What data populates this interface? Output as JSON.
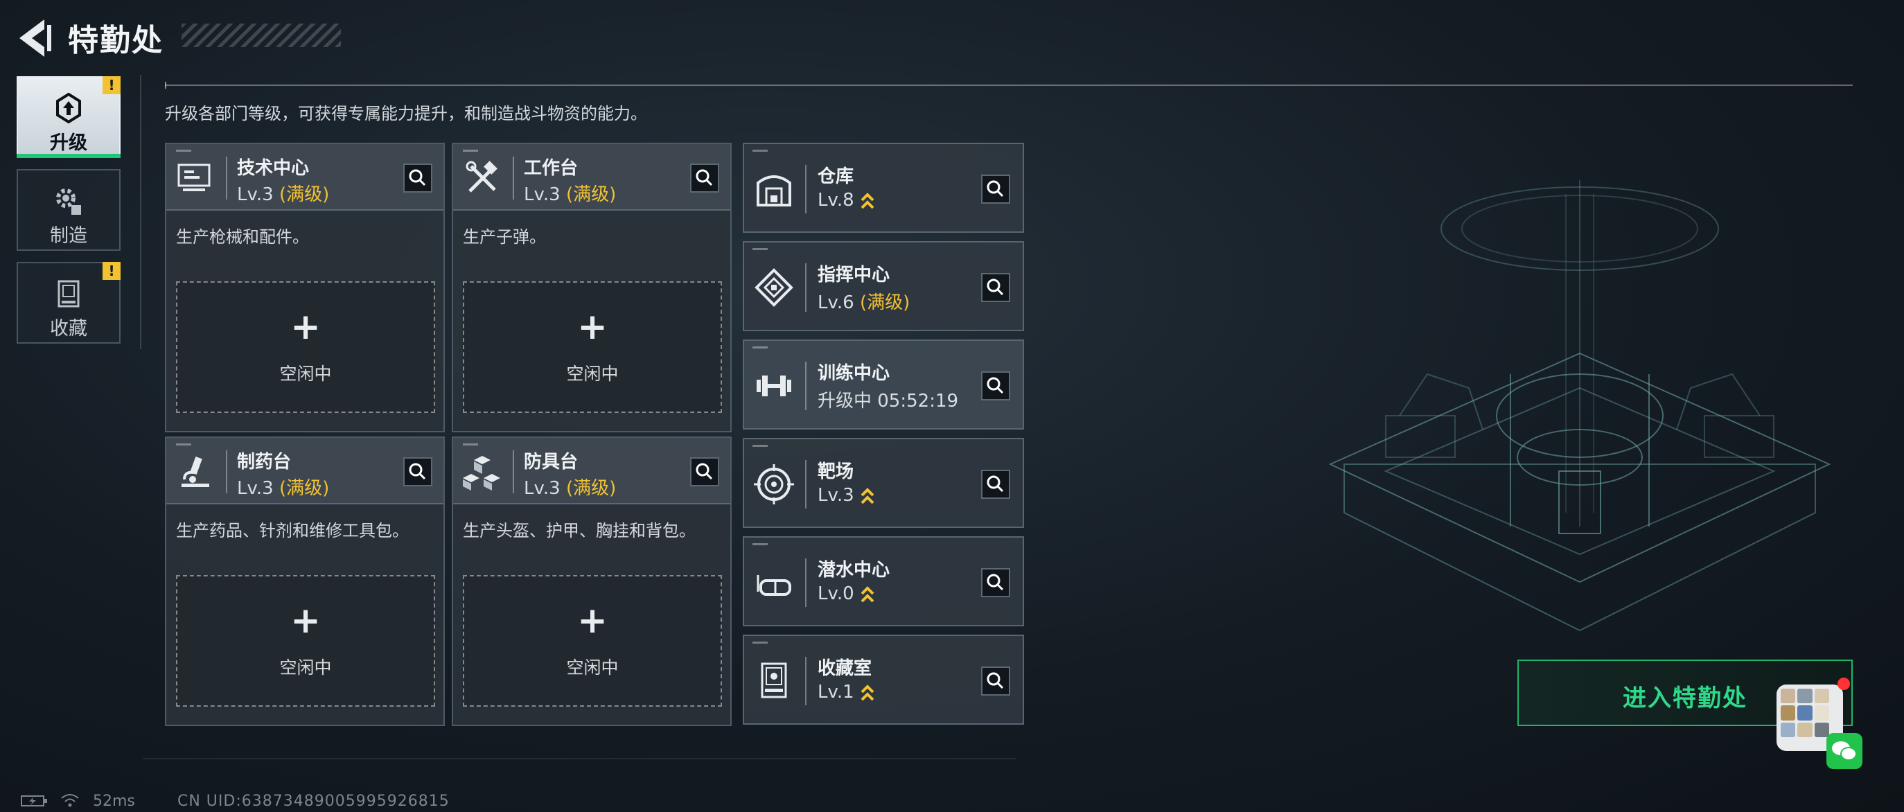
{
  "header": {
    "title": "特勤处"
  },
  "nav": {
    "items": [
      {
        "label": "升级",
        "icon": "upgrade-icon",
        "active": true,
        "badge": "!"
      },
      {
        "label": "制造",
        "icon": "gear-icon",
        "active": false,
        "badge": ""
      },
      {
        "label": "收藏",
        "icon": "collection-icon",
        "active": false,
        "badge": "!"
      }
    ]
  },
  "main": {
    "description": "升级各部门等级，可获得专属能力提升，和制造战斗物资的能力。",
    "cards": [
      {
        "name": "技术中心",
        "level": "Lv.3",
        "status": "(满级)",
        "desc": "生产枪械和配件。",
        "slot_plus": "+",
        "slot_label": "空闲中",
        "icon": "monitor-icon"
      },
      {
        "name": "工作台",
        "level": "Lv.3",
        "status": "(满级)",
        "desc": "生产子弹。",
        "slot_plus": "+",
        "slot_label": "空闲中",
        "icon": "tools-icon"
      },
      {
        "name": "制药台",
        "level": "Lv.3",
        "status": "(满级)",
        "desc": "生产药品、针剂和维修工具包。",
        "slot_plus": "+",
        "slot_label": "空闲中",
        "icon": "microscope-icon"
      },
      {
        "name": "防具台",
        "level": "Lv.3",
        "status": "(满级)",
        "desc": "生产头盔、护甲、胸挂和背包。",
        "slot_plus": "+",
        "slot_label": "空闲中",
        "icon": "armor-boxes-icon"
      }
    ],
    "facilities": [
      {
        "name": "仓库",
        "level": "Lv.8",
        "status": "",
        "upgradable": true,
        "icon": "warehouse-icon"
      },
      {
        "name": "指挥中心",
        "level": "Lv.6",
        "status": "(满级)",
        "upgradable": false,
        "icon": "command-icon"
      },
      {
        "name": "训练中心",
        "level": "",
        "status": "升级中 05:52:19",
        "upgradable": false,
        "icon": "dumbbell-icon"
      },
      {
        "name": "靶场",
        "level": "Lv.3",
        "status": "",
        "upgradable": true,
        "icon": "target-icon"
      },
      {
        "name": "潜水中心",
        "level": "Lv.0",
        "status": "",
        "upgradable": true,
        "icon": "diving-mask-icon"
      },
      {
        "name": "收藏室",
        "level": "Lv.1",
        "status": "",
        "upgradable": true,
        "icon": "display-case-icon"
      }
    ]
  },
  "enter_button": {
    "label": "进入特勤处"
  },
  "status_bar": {
    "ping": "52ms",
    "uid": "CN UID:6387348900599592681‌5"
  },
  "colors": {
    "accent_green": "#21b46a",
    "max_yellow": "#f2c232",
    "badge_yellow": "#f2c232"
  }
}
